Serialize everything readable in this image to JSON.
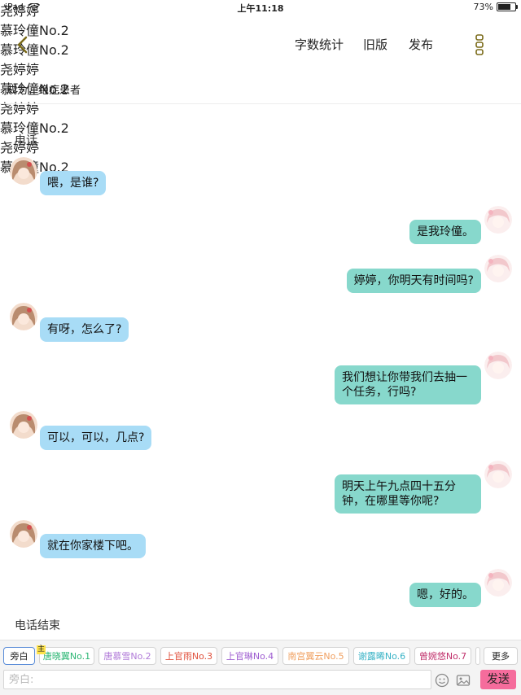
{
  "status_bar": {
    "device": "iPad",
    "time": "上午11:18",
    "battery": "73%"
  },
  "nav": {
    "word_count": "字数统计",
    "old_version": "旧版",
    "publish": "发布"
  },
  "subtitle": "成为，绝症患者",
  "dot": "·",
  "narrations": {
    "start": "电话",
    "end": "电话结束"
  },
  "messages": [
    {
      "side": "left",
      "name": "尧婷婷",
      "text": "喂，是谁?"
    },
    {
      "side": "right",
      "name": "慕玲僮No.2",
      "text": "是我玲僮。"
    },
    {
      "side": "right",
      "name": "慕玲僮No.2",
      "text": "婷婷，你明天有时间吗?"
    },
    {
      "side": "left",
      "name": "尧婷婷",
      "text": "有呀，怎么了?"
    },
    {
      "side": "right",
      "name": "慕玲僮No.2",
      "text": "我们想让你带我们去抽一个任务，行吗?"
    },
    {
      "side": "left",
      "name": "尧婷婷",
      "text": "可以，可以，几点?"
    },
    {
      "side": "right",
      "name": "慕玲僮No.2",
      "text": "明天上午九点四十五分钟，在哪里等你呢?"
    },
    {
      "side": "left",
      "name": "尧婷婷",
      "text": "就在你家楼下吧。"
    },
    {
      "side": "right",
      "name": "慕玲僮No.2",
      "text": "嗯，好的。"
    }
  ],
  "characters": [
    {
      "label": "旁白",
      "color": "#222222"
    },
    {
      "label": "唐晓翼No.1",
      "color": "#2bb673",
      "badge": "主"
    },
    {
      "label": "唐慕雪No.2",
      "color": "#b07ad8"
    },
    {
      "label": "上官雨No.3",
      "color": "#e0503c"
    },
    {
      "label": "上官琳No.4",
      "color": "#9d5bd0"
    },
    {
      "label": "南宫翼云No.5",
      "color": "#f0a060"
    },
    {
      "label": "谢露晞No.6",
      "color": "#39b3c6"
    },
    {
      "label": "曾婉悠No.7",
      "color": "#c0306b"
    }
  ],
  "more_label": "更多",
  "input": {
    "placeholder": "旁白:"
  },
  "send_label": "发送",
  "colors": {
    "left_bubble": "#a8dcf6",
    "right_bubble": "#87d8cc",
    "send": "#f56c9c",
    "accent": "#7a6a18"
  }
}
